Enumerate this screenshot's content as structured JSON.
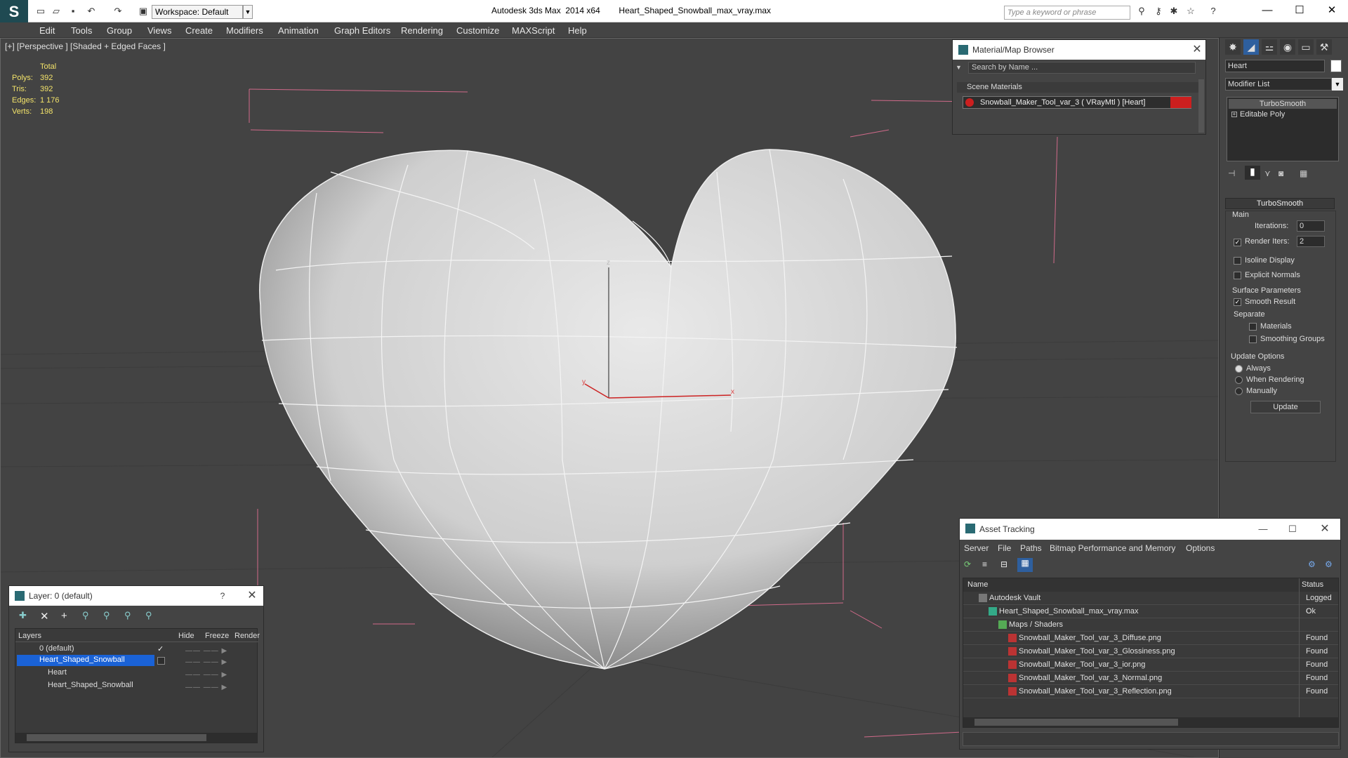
{
  "title_bar": {
    "app_title": "Autodesk 3ds Max  2014 x64        Heart_Shaped_Snowball_max_vray.max",
    "workspace": "Workspace: Default",
    "search_placeholder": "Type a keyword or phrase",
    "logo_icon": "3ds-max-logo-icon"
  },
  "menu": [
    "Edit",
    "Tools",
    "Group",
    "Views",
    "Create",
    "Modifiers",
    "Animation",
    "Graph Editors",
    "Rendering",
    "Customize",
    "MAXScript",
    "Help"
  ],
  "viewport": {
    "label": "[+] [Perspective ] [Shaded + Edged Faces ]",
    "stats_header": "Total",
    "stats": [
      {
        "label": "Polys:",
        "value": "392"
      },
      {
        "label": "Tris:",
        "value": "392"
      },
      {
        "label": "Edges:",
        "value": "1 176"
      },
      {
        "label": "Verts:",
        "value": "198"
      }
    ],
    "axes": {
      "z": "z",
      "y": "y",
      "x": "x"
    }
  },
  "material_browser": {
    "title": "Material/Map Browser",
    "search_placeholder": "Search by Name ...",
    "group": "Scene Materials",
    "item": "Snowball_Maker_Tool_var_3  ( VRayMtl ) [Heart]"
  },
  "command_panel": {
    "object_name": "Heart",
    "modifier_list": "Modifier List",
    "stack": [
      "TurboSmooth",
      "Editable Poly"
    ],
    "rollout_title": "TurboSmooth",
    "main_label": "Main",
    "iterations_label": "Iterations:",
    "iterations_value": "0",
    "render_iters_label": "Render Iters:",
    "render_iters_value": "2",
    "isoline_display": "Isoline Display",
    "explicit_normals": "Explicit Normals",
    "surface_params": "Surface Parameters",
    "smooth_result": "Smooth Result",
    "separate": "Separate",
    "materials": "Materials",
    "smoothing_groups": "Smoothing Groups",
    "update_options": "Update Options",
    "always": "Always",
    "when_rendering": "When Rendering",
    "manually": "Manually",
    "update_button": "Update"
  },
  "layer_panel": {
    "title": "Layer: 0 (default)",
    "help": "?",
    "columns": [
      "Layers",
      "Hide",
      "Freeze",
      "Render"
    ],
    "rows": [
      "0 (default)",
      "Heart_Shaped_Snowball",
      "Heart",
      "Heart_Shaped_Snowball"
    ]
  },
  "asset_tracking": {
    "title": "Asset Tracking",
    "menu": [
      "Server",
      "File",
      "Paths",
      "Bitmap Performance and Memory",
      "Options"
    ],
    "columns": [
      "Name",
      "Status"
    ],
    "rows": [
      {
        "name": "Autodesk Vault",
        "status": "Logged C",
        "indent": 0
      },
      {
        "name": "Heart_Shaped_Snowball_max_vray.max",
        "status": "Ok",
        "indent": 1
      },
      {
        "name": "Maps / Shaders",
        "status": "",
        "indent": 2
      },
      {
        "name": "Snowball_Maker_Tool_var_3_Diffuse.png",
        "status": "Found",
        "indent": 3
      },
      {
        "name": "Snowball_Maker_Tool_var_3_Glossiness.png",
        "status": "Found",
        "indent": 3
      },
      {
        "name": "Snowball_Maker_Tool_var_3_ior.png",
        "status": "Found",
        "indent": 3
      },
      {
        "name": "Snowball_Maker_Tool_var_3_Normal.png",
        "status": "Found",
        "indent": 3
      },
      {
        "name": "Snowball_Maker_Tool_var_3_Reflection.png",
        "status": "Found",
        "indent": 3
      }
    ]
  },
  "colors": {
    "selection": "#1a62d6",
    "stats": "#f3e36a",
    "material_swatch": "#cc1f1f"
  }
}
